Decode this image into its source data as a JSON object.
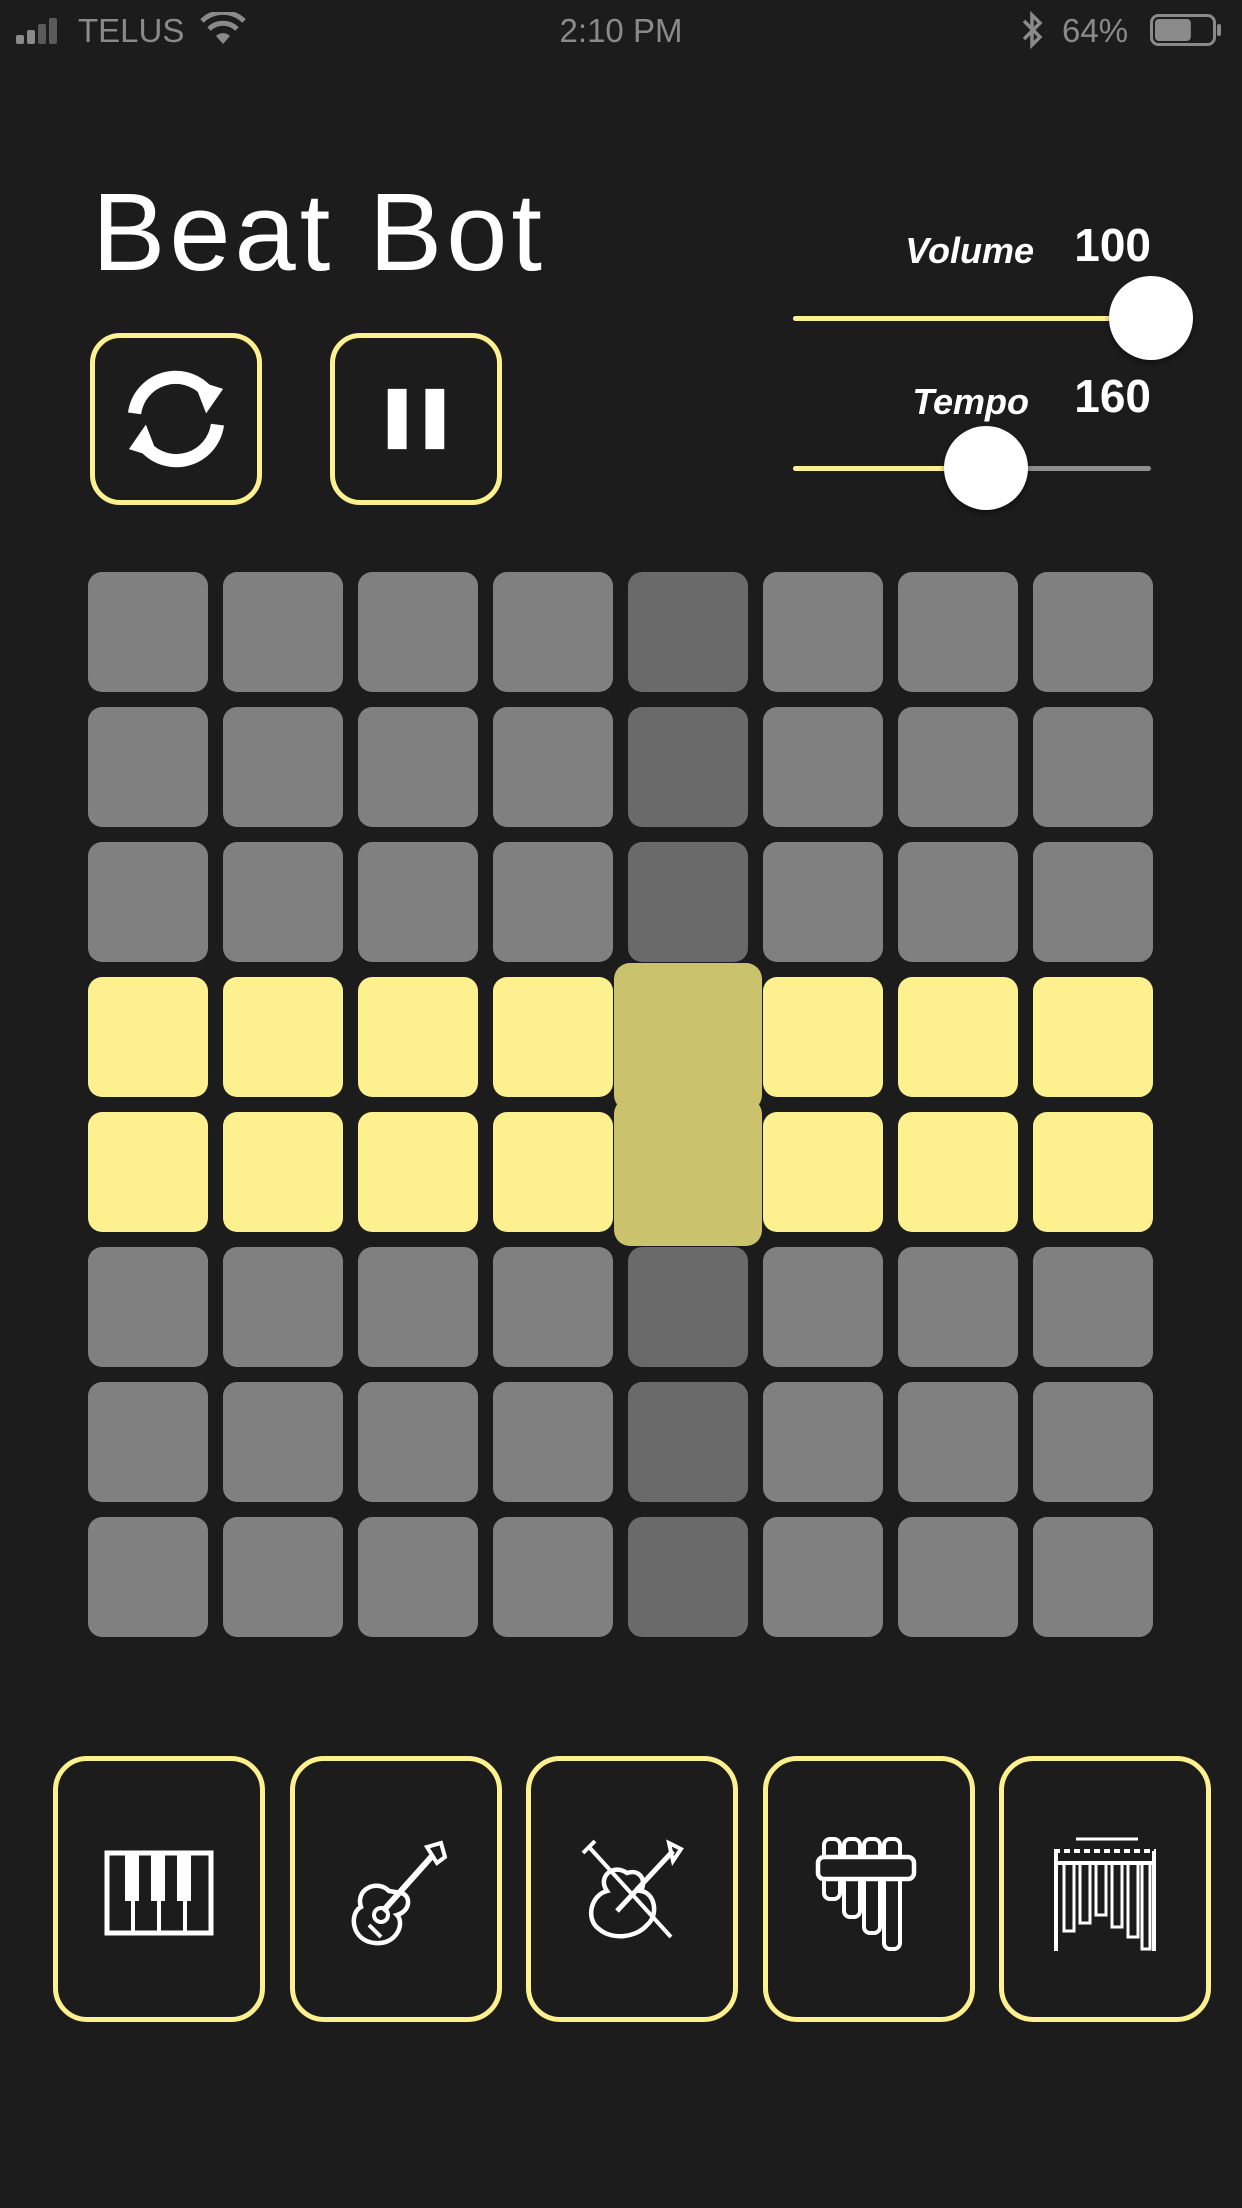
{
  "status_bar": {
    "carrier": "TELUS",
    "time": "2:10 PM",
    "battery": "64%",
    "battery_level": 0.64
  },
  "app": {
    "title": "Beat Bot"
  },
  "controls": {
    "reset_icon": "refresh-icon",
    "pause_icon": "pause-icon"
  },
  "sliders": {
    "volume": {
      "label": "Volume",
      "value": "100",
      "level": 1.0
    },
    "tempo": {
      "label": "Tempo",
      "value": "160",
      "level": 0.54
    }
  },
  "grid": {
    "rows": 8,
    "cols": 8,
    "current_step": 4,
    "active_rows": [
      3,
      4
    ]
  },
  "instruments": [
    {
      "name": "piano",
      "icon": "piano-icon"
    },
    {
      "name": "guitar",
      "icon": "guitar-icon"
    },
    {
      "name": "violin",
      "icon": "violin-icon"
    },
    {
      "name": "pan-flute",
      "icon": "pan-flute-icon"
    },
    {
      "name": "xylophone",
      "icon": "xylophone-icon"
    }
  ],
  "colors": {
    "accent": "#fdf08e",
    "background": "#1c1c1c",
    "cell_off": "#808080",
    "cell_off_current": "#6a6a6a",
    "cell_on_current": "#cbc26d"
  }
}
